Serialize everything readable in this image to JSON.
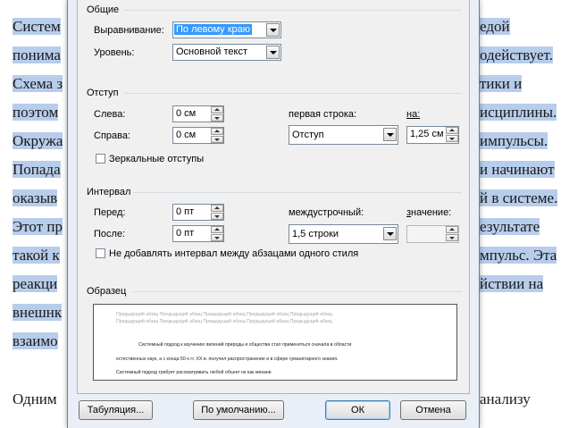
{
  "document": {
    "left_lines": [
      "Систем",
      "понима",
      "Схема з",
      "поэтом",
      "Окружа",
      "Попада",
      "оказыв",
      "Этот пр",
      "такой к",
      "реакци",
      "внешнк",
      "взаимо"
    ],
    "right_lines": [
      "едой",
      "одействует.",
      "тики и",
      "исциплины.",
      "импульсы.",
      "и начинают",
      "й в системе.",
      "езультате",
      "мпульс. Эта",
      "йствии на",
      "",
      ""
    ],
    "last_line_left": "Одним",
    "last_line_right": "анализу"
  },
  "dialog": {
    "general": {
      "title": "Общие",
      "alignment_label": "Выравнивание:",
      "alignment_value": "По левому краю",
      "level_label": "Уровень:",
      "level_value": "Основной текст"
    },
    "indent": {
      "title": "Отступ",
      "left_label": "Слева:",
      "left_value": "0 см",
      "right_label": "Справа:",
      "right_value": "0 см",
      "first_line_label": "первая строка:",
      "first_line_value": "Отступ",
      "by_label": "на:",
      "by_value": "1,25 см",
      "mirror_label": "Зеркальные отступы",
      "mirror_checked": false
    },
    "spacing": {
      "title": "Интервал",
      "before_label": "Перед:",
      "before_value": "0 пт",
      "after_label": "После:",
      "after_value": "0 пт",
      "line_spacing_label": "междустрочный:",
      "line_spacing_value": "1,5 строки",
      "value_label": "значение:",
      "value_value": "",
      "no_space_label": "Не добавлять интервал между абзацами одного стиля",
      "no_space_checked": false
    },
    "preview": {
      "title": "Образец",
      "prev_lines": [
        "Предыдущий абзац Предыдущий абзац Предыдущий абзац Предыдущий абзац Предыдущий абзац",
        "Предыдущий абзац Предыдущий абзац Предыдущий абзац Предыдущий абзац Предыдущий абзац"
      ],
      "sample_lines": [
        "Системный подход к изучению явлений природы и общества стал применяться сначала в области",
        "естественных наук, а с конца 50-х гг. XX в. получил распространение и в сфере гуманитарного знания.",
        "Системный подход требует рассматривать любой объект не как механи"
      ]
    },
    "buttons": {
      "tabs": "Табуляция...",
      "default": "По умолчанию...",
      "ok": "ОК",
      "cancel": "Отмена"
    }
  }
}
